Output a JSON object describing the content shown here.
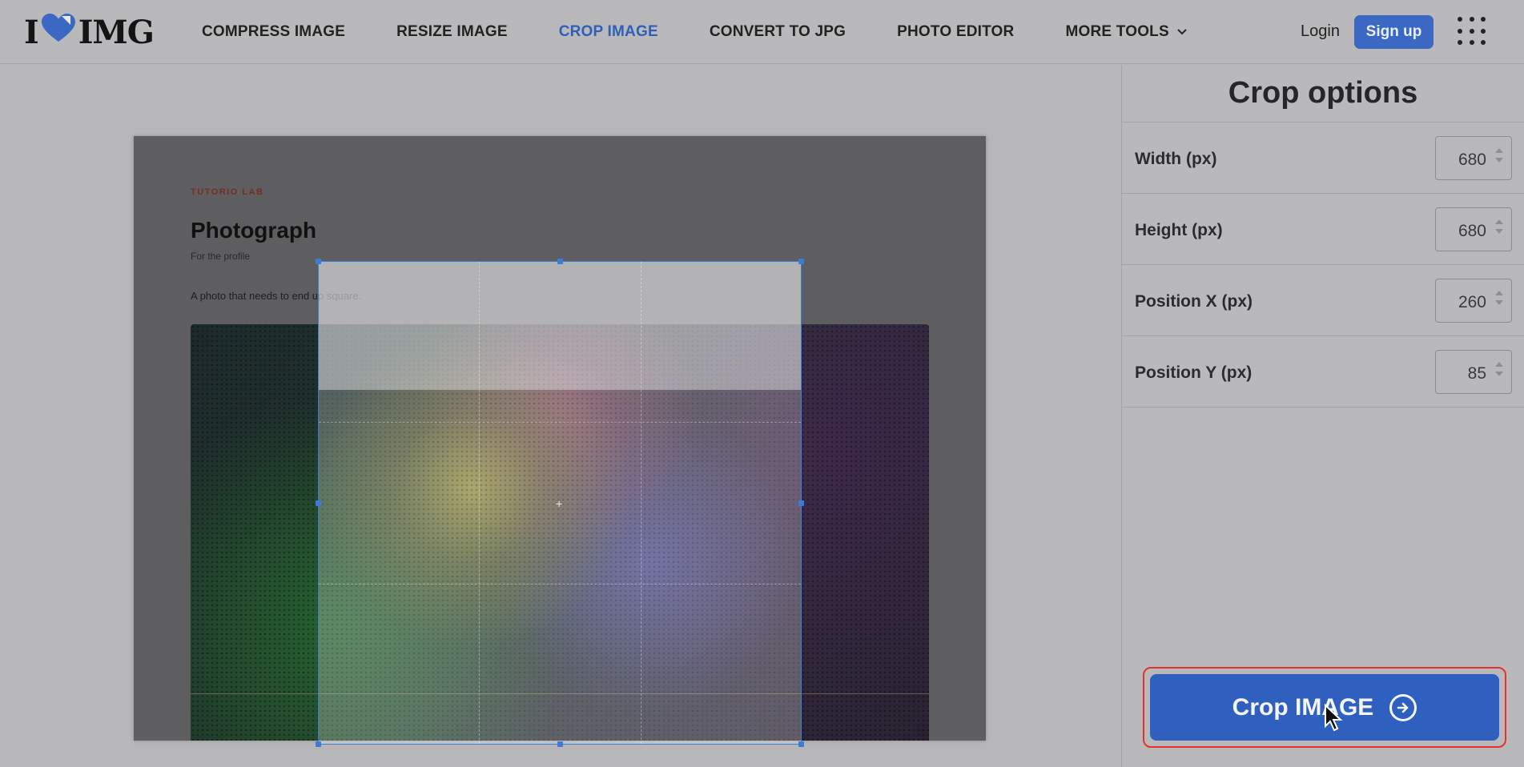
{
  "header": {
    "logo_left": "I",
    "logo_right": "IMG",
    "nav": [
      {
        "label": "COMPRESS IMAGE"
      },
      {
        "label": "RESIZE IMAGE"
      },
      {
        "label": "CROP IMAGE"
      },
      {
        "label": "CONVERT TO JPG"
      },
      {
        "label": "PHOTO EDITOR"
      },
      {
        "label": "MORE TOOLS"
      }
    ],
    "login": "Login",
    "signup": "Sign up"
  },
  "document": {
    "label": "TUTORIO LAB",
    "title": "Photograph",
    "subtitle": "For the profile",
    "body": "A photo that needs to end up square."
  },
  "sidebar": {
    "title": "Crop options",
    "fields": [
      {
        "label": "Width (px)",
        "value": "680"
      },
      {
        "label": "Height (px)",
        "value": "680"
      },
      {
        "label": "Position X (px)",
        "value": "260"
      },
      {
        "label": "Position Y (px)",
        "value": "85"
      }
    ],
    "action_label": "Crop IMAGE"
  },
  "colors": {
    "accent": "#3a68c2",
    "active_nav": "#2f5fb7",
    "highlight_border": "#e5322d",
    "crop_border": "#3c7bd6"
  }
}
